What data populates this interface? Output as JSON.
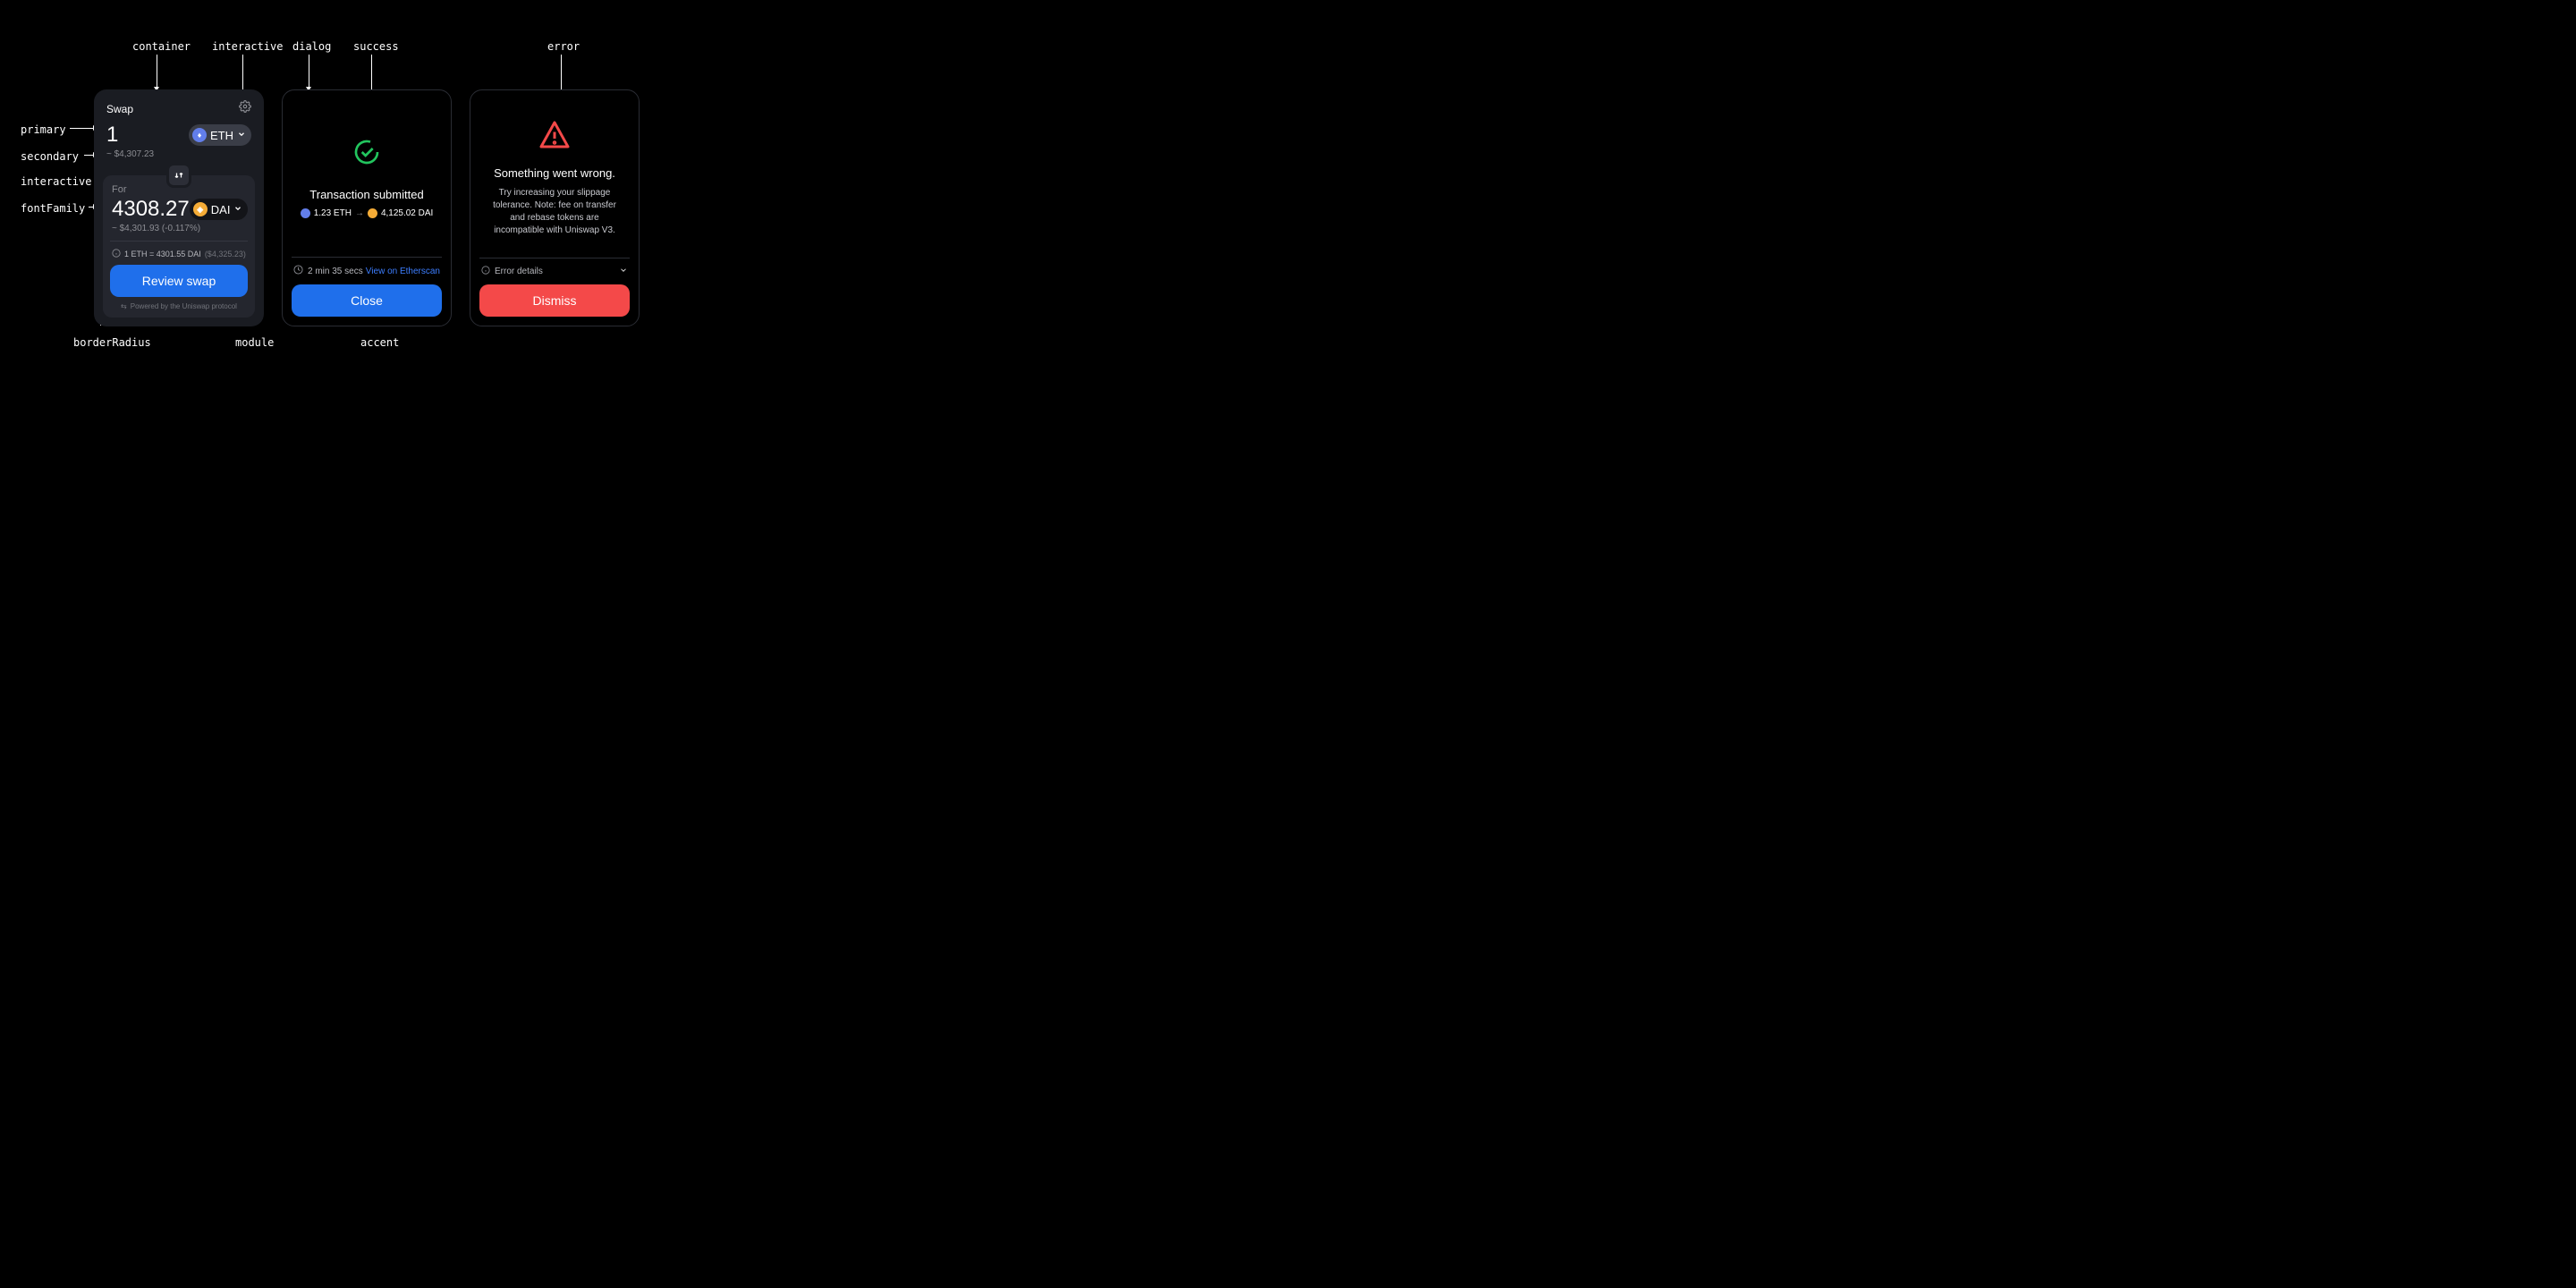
{
  "annotations": {
    "container": "container",
    "interactiveTop": "interactive",
    "primary": "primary",
    "secondary": "secondary",
    "interactiveMid": "interactive",
    "fontFamily": "fontFamily",
    "borderRadius": "borderRadius",
    "module": "module",
    "dialog": "dialog",
    "success": "success",
    "accent": "accent",
    "error": "error"
  },
  "swap": {
    "title": "Swap",
    "sellAmount": "1",
    "sellToken": "ETH",
    "sellUsd": "~ $4,307.23",
    "forLabel": "For",
    "buyAmount": "4308.27",
    "buyToken": "DAI",
    "buyUsd": "~ $4,301.93 (-0.117%)",
    "rate": "1 ETH = 4301.55 DAI",
    "rateUsd": "($4,325.23)",
    "reviewButton": "Review swap",
    "powered": "Powered by the Uniswap protocol"
  },
  "txDialog": {
    "title": "Transaction submitted",
    "fromAmount": "1.23 ETH",
    "toAmount": "4,125.02 DAI",
    "time": "2 min 35 secs",
    "viewLink": "View on Etherscan",
    "closeButton": "Close"
  },
  "errorDialog": {
    "title": "Something went wrong.",
    "description": "Try increasing your slippage tolerance. Note: fee on transfer and rebase tokens are incompatible with Uniswap V3.",
    "detailsLabel": "Error details",
    "dismissButton": "Dismiss"
  }
}
